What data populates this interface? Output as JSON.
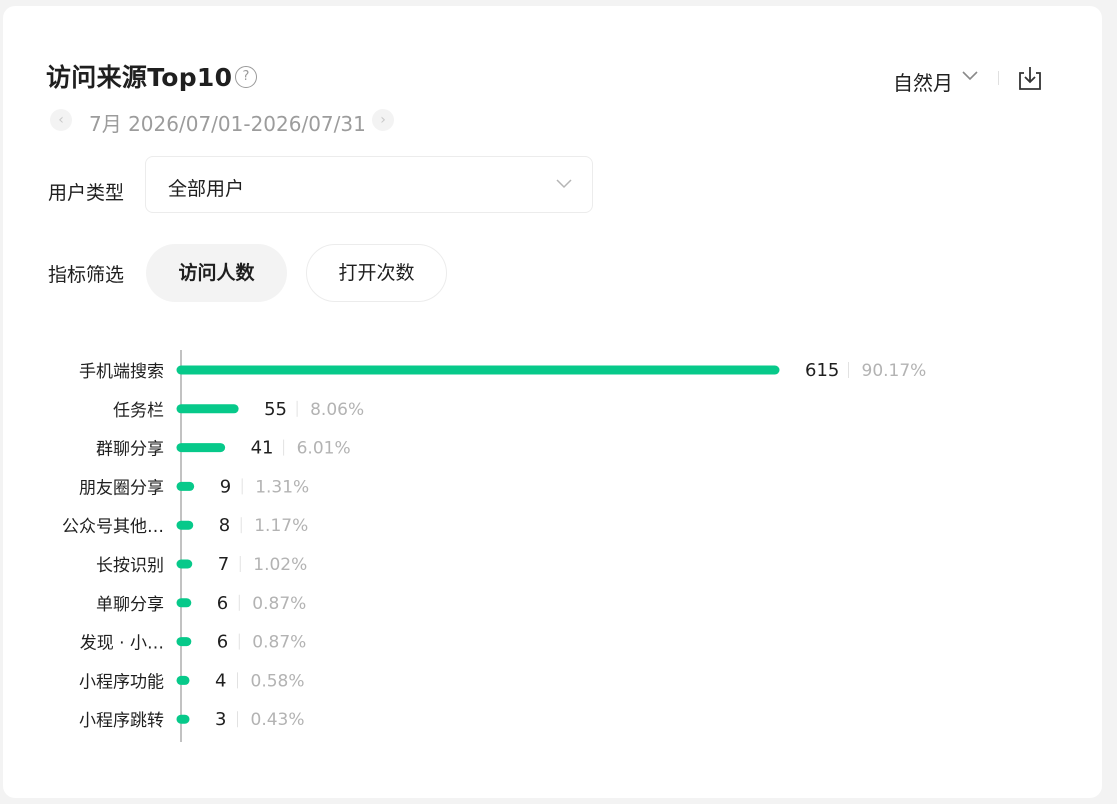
{
  "header": {
    "title": "访问来源Top10",
    "help_icon": "question-circle-icon",
    "date_range": "7月 2026/07/01-2026/07/31",
    "prev_icon": "chevron-left-icon",
    "next_icon": "chevron-right-icon",
    "period_label": "自然月",
    "download_icon": "download-icon"
  },
  "filters": {
    "user_type_label": "用户类型",
    "user_type_value": "全部用户",
    "metric_label": "指标筛选",
    "metric_options": [
      "访问人数",
      "打开次数"
    ],
    "metric_selected": "访问人数"
  },
  "colors": {
    "bar": "#07c98a",
    "text": "#1f1f1f",
    "muted": "#b3b3b3"
  },
  "chart_data": {
    "type": "bar",
    "orientation": "horizontal",
    "categories": [
      "手机端搜索",
      "任务栏",
      "群聊分享",
      "朋友圈分享",
      "公众号其他…",
      "长按识别",
      "单聊分享",
      "发现 · 小…",
      "小程序功能",
      "小程序跳转"
    ],
    "values": [
      615,
      55,
      41,
      9,
      8,
      7,
      6,
      6,
      4,
      3
    ],
    "percentages": [
      "90.17%",
      "8.06%",
      "6.01%",
      "1.31%",
      "1.17%",
      "1.02%",
      "0.87%",
      "0.87%",
      "0.58%",
      "0.43%"
    ],
    "title": "",
    "xlabel": "",
    "ylabel": "",
    "xlim": [
      0,
      615
    ],
    "grid": false
  }
}
